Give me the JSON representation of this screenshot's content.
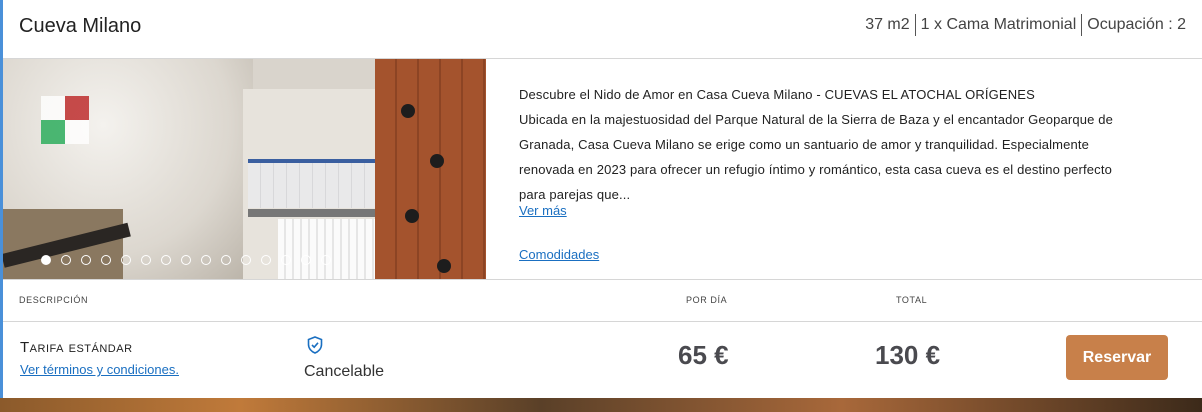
{
  "room": {
    "title": "Cueva Milano",
    "specs": [
      "37 m2",
      "1 x Cama Matrimonial",
      "Ocupación : 2"
    ]
  },
  "gallery": {
    "slide_count": 15,
    "active_index": 0,
    "dot_icon": "carousel-dot"
  },
  "description": {
    "heading": "Descubre el Nido de Amor en Casa Cueva Milano - CUEVAS EL ATOCHAL ORÍGENES",
    "body": "Ubicada en la majestuosidad del Parque Natural de la Sierra de Baza y el encantador Geoparque de Granada, Casa Cueva Milano se erige como un santuario de amor y tranquilidad. Especialmente renovada en 2023 para ofrecer un refugio íntimo y romántico, esta casa cueva es el destino perfecto para parejas que...",
    "more_link": "Ver más",
    "amenities_link": "Comodidades"
  },
  "table": {
    "headers": {
      "description": "Descripción",
      "per_day": "Por día",
      "total": "Total"
    },
    "rate": {
      "name": "Tarifa estándar",
      "terms_link": "Ver términos y condiciones.",
      "cancel_icon": "shield-check-icon",
      "cancel_label": "Cancelable",
      "price_per_day": "65 €",
      "price_total": "130 €",
      "reserve_label": "Reservar"
    }
  },
  "colors": {
    "accent": "#c8804a",
    "link": "#1a6fc1",
    "left_border": "#4a90d9"
  }
}
